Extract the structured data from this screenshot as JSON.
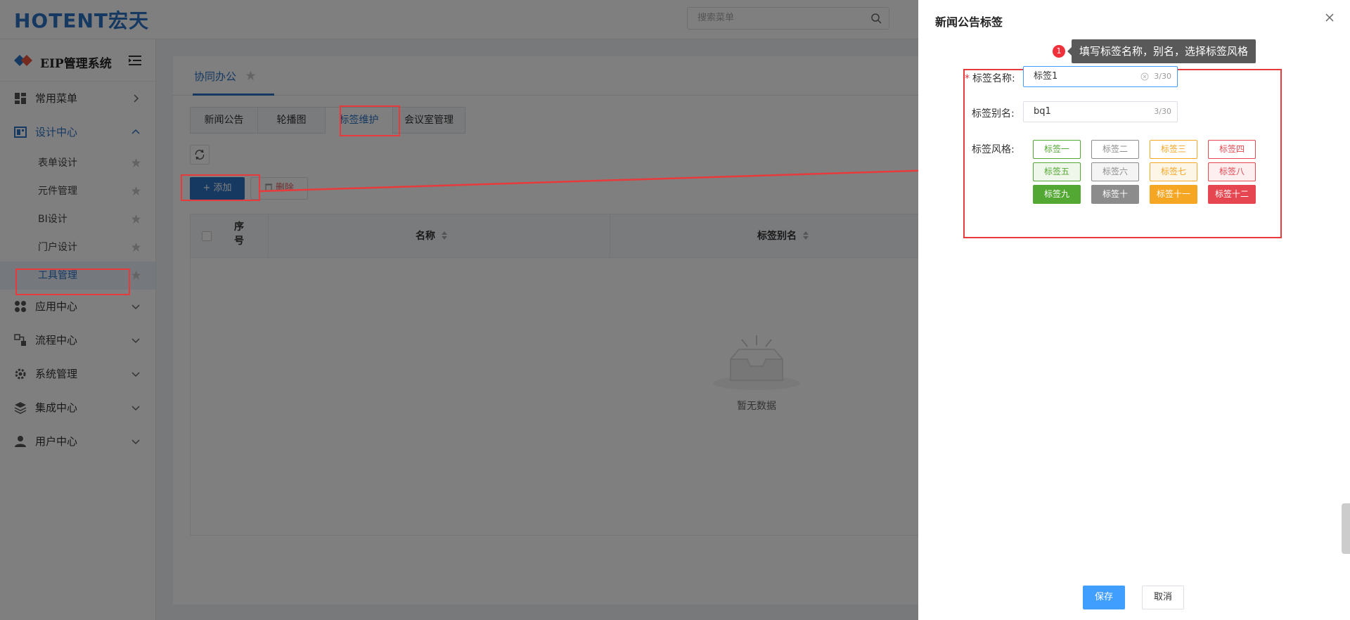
{
  "header": {
    "logo_text": "HOTENT宏天",
    "search_placeholder": "搜索菜单"
  },
  "sidebar": {
    "title": "EIP管理系统",
    "items": [
      {
        "label": "常用菜单",
        "icon": "dashboard-icon"
      },
      {
        "label": "设计中心",
        "icon": "design-icon",
        "expanded": true
      },
      {
        "label": "应用中心",
        "icon": "apps-icon"
      },
      {
        "label": "流程中心",
        "icon": "flow-icon"
      },
      {
        "label": "系统管理",
        "icon": "gear-icon"
      },
      {
        "label": "集成中心",
        "icon": "layers-icon"
      },
      {
        "label": "用户中心",
        "icon": "user-icon"
      }
    ],
    "submenu": [
      {
        "label": "表单设计"
      },
      {
        "label": "元件管理"
      },
      {
        "label": "BI设计"
      },
      {
        "label": "门户设计"
      },
      {
        "label": "工具管理"
      }
    ]
  },
  "main": {
    "tab_label": "协同办公",
    "subtabs": [
      "新闻公告",
      "轮播图",
      "标签维护",
      "会议室管理"
    ],
    "add_label": "+ 添加",
    "delete_label": "删除",
    "columns": [
      "序号",
      "名称",
      "标签别名"
    ],
    "empty_text": "暂无数据"
  },
  "drawer": {
    "title": "新闻公告标签",
    "tooltip_badge": "1",
    "tooltip_text": "填写标签名称，别名，选择标签风格",
    "name_label": "标签名称:",
    "name_value": "标签1",
    "name_count": "3/30",
    "alias_label": "标签别名:",
    "alias_value": "bq1",
    "alias_count": "3/30",
    "style_label": "标签风格:",
    "tags": [
      {
        "label": "标签一",
        "color": "#52a833",
        "bg": "#ffffff"
      },
      {
        "label": "标签二",
        "color": "#8c8c8c",
        "bg": "#ffffff"
      },
      {
        "label": "标签三",
        "color": "#f5a623",
        "bg": "#ffffff"
      },
      {
        "label": "标签四",
        "color": "#e5464f",
        "bg": "#ffffff"
      },
      {
        "label": "标签五",
        "color": "#52a833",
        "bg": "#eef7e9"
      },
      {
        "label": "标签六",
        "color": "#8c8c8c",
        "bg": "#f4f4f5"
      },
      {
        "label": "标签七",
        "color": "#f5a623",
        "bg": "#fdf5e6"
      },
      {
        "label": "标签八",
        "color": "#e5464f",
        "bg": "#fdeeef"
      },
      {
        "label": "标签九",
        "color": "#ffffff",
        "bg": "#52a833"
      },
      {
        "label": "标签十",
        "color": "#ffffff",
        "bg": "#8c8c8c"
      },
      {
        "label": "标签十一",
        "color": "#ffffff",
        "bg": "#f5a623"
      },
      {
        "label": "标签十二",
        "color": "#ffffff",
        "bg": "#e5464f"
      }
    ],
    "save_label": "保存",
    "cancel_label": "取消"
  }
}
